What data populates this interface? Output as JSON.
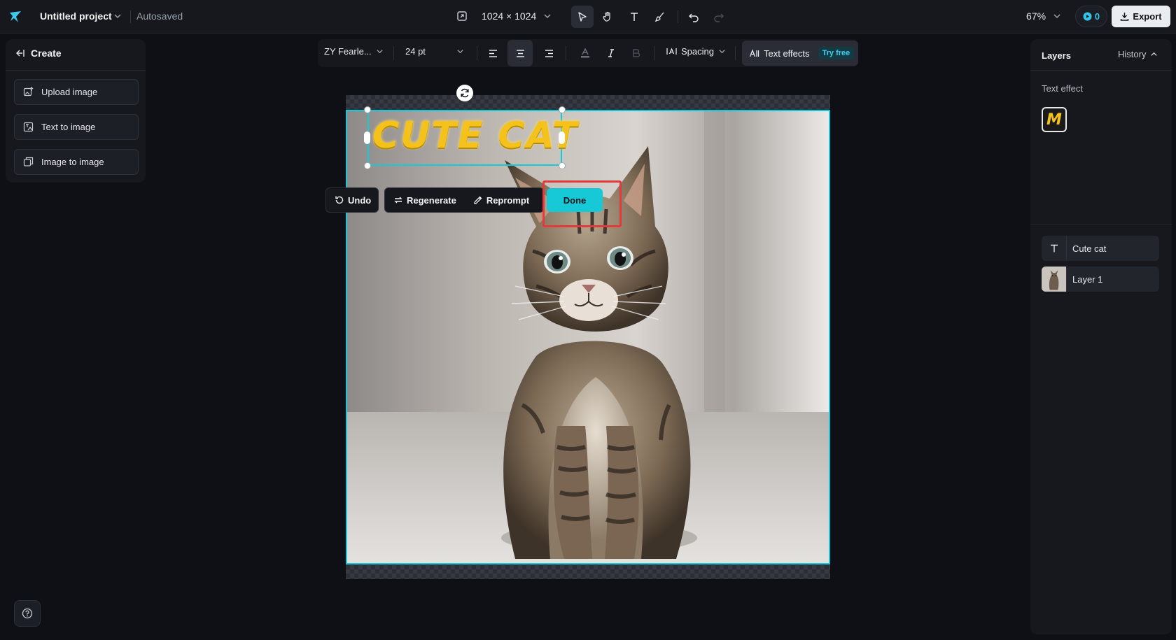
{
  "header": {
    "project_title": "Untitled project",
    "autosave_status": "Autosaved",
    "canvas_size": "1024 × 1024",
    "zoom": "67%",
    "credits": "0",
    "export_label": "Export",
    "tools": [
      "select-tool",
      "hand-tool",
      "text-tool",
      "brush-tool",
      "undo",
      "redo"
    ]
  },
  "left_panel": {
    "title": "Create",
    "items": [
      {
        "label": "Upload image",
        "icon": "upload-image-icon"
      },
      {
        "label": "Text to image",
        "icon": "text-to-image-icon"
      },
      {
        "label": "Image to image",
        "icon": "image-to-image-icon"
      }
    ]
  },
  "text_toolbar": {
    "font": "ZY Fearle...",
    "size": "24 pt",
    "spacing_label": "Spacing",
    "text_effects_label": "Text effects",
    "try_free": "Try free"
  },
  "canvas": {
    "text_layer": "CUTE CAT",
    "selection_color": "#17c9d6",
    "text_color": "#f4c21a"
  },
  "action_bar": {
    "undo": "Undo",
    "regenerate": "Regenerate",
    "reprompt": "Reprompt",
    "done": "Done"
  },
  "right_panel": {
    "layers_tab": "Layers",
    "history_tab": "History",
    "text_effect_label": "Text effect",
    "layers": [
      {
        "name": "Cute cat",
        "icon": "text-icon"
      },
      {
        "name": "Layer 1",
        "icon": "image-thumbnail"
      }
    ]
  }
}
